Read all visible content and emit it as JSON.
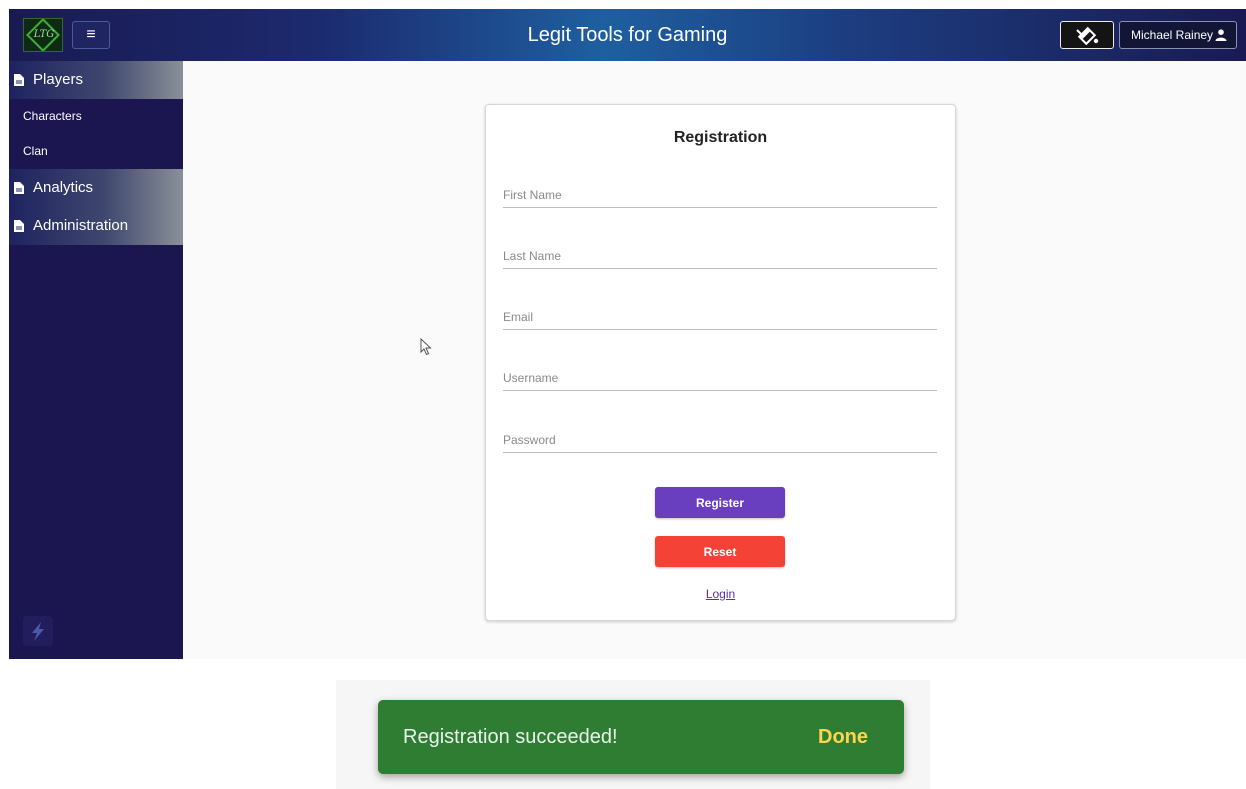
{
  "header": {
    "logo_text": "LTG",
    "menu_icon": "≡",
    "title": "Legit Tools for Gaming",
    "theme_icon": "paint-bucket-icon",
    "user_name": "Michael Rainey",
    "user_icon": "user-icon"
  },
  "sidebar": {
    "groups": [
      {
        "label": "Players",
        "icon": "document-icon",
        "items": [
          {
            "label": "Characters"
          },
          {
            "label": "Clan"
          }
        ]
      },
      {
        "label": "Analytics",
        "icon": "document-icon",
        "items": []
      },
      {
        "label": "Administration",
        "icon": "document-icon",
        "items": []
      }
    ],
    "bottom_icon": "lightning-icon"
  },
  "form": {
    "title": "Registration",
    "fields": [
      {
        "placeholder": "First Name",
        "value": ""
      },
      {
        "placeholder": "Last Name",
        "value": ""
      },
      {
        "placeholder": "Email",
        "value": ""
      },
      {
        "placeholder": "Username",
        "value": ""
      },
      {
        "placeholder": "Password",
        "value": ""
      }
    ],
    "register_label": "Register",
    "reset_label": "Reset",
    "login_label": "Login"
  },
  "toast": {
    "message": "Registration succeeded!",
    "action_label": "Done"
  },
  "colors": {
    "sidebar_bg": "#1b1550",
    "register": "#6a3fbf",
    "reset": "#f44336",
    "toast_bg": "#2e7d32",
    "toast_action": "#ffd54f"
  }
}
